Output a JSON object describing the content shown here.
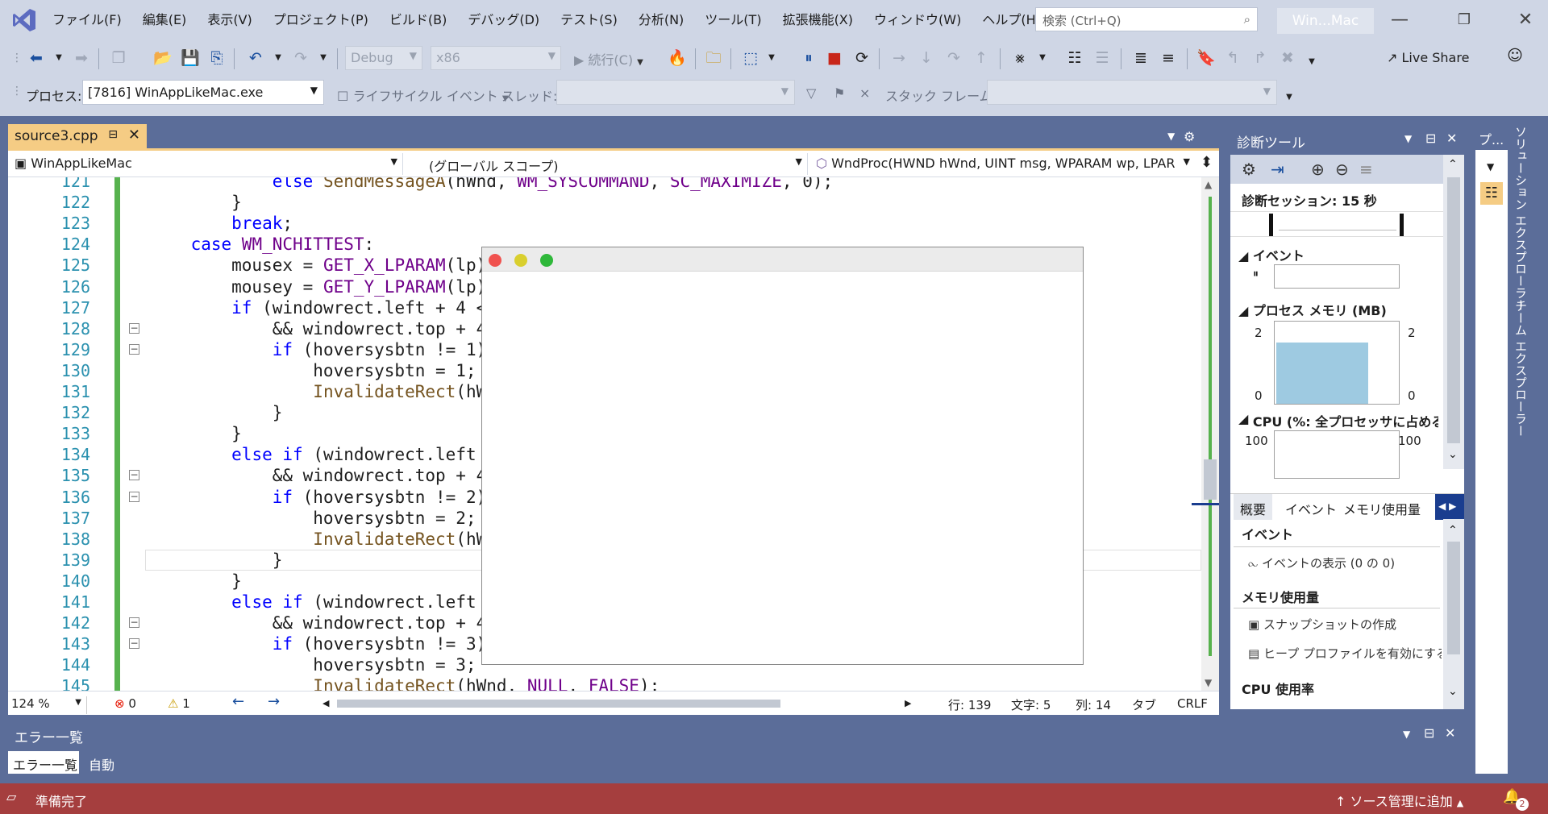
{
  "menubar": {
    "items": [
      "ファイル(F)",
      "編集(E)",
      "表示(V)",
      "プロジェクト(P)",
      "ビルド(B)",
      "デバッグ(D)",
      "テスト(S)",
      "分析(N)",
      "ツール(T)",
      "拡張機能(X)",
      "ウィンドウ(W)",
      "ヘルプ(H)"
    ],
    "search_placeholder": "検索 (Ctrl+Q)",
    "window_title": "Win...Mac"
  },
  "toolbar": {
    "config": "Debug",
    "platform": "x86",
    "continue_label": "続行(C)",
    "live_share": "Live Share"
  },
  "process_bar": {
    "label": "プロセス:",
    "process": "[7816] WinAppLikeMac.exe",
    "lifecycle": "ライフサイクル イベント",
    "thread": "スレッド:",
    "stack_frame": "スタック フレーム:"
  },
  "editor": {
    "tab_title": "source3.cpp",
    "nav_project": "WinAppLikeMac",
    "nav_scope": "(グローバル スコープ)",
    "nav_function": "WndProc(HWND hWnd, UINT msg, WPARAM wp, LPAR",
    "zoom": "124 %",
    "errors": "0",
    "warnings": "1",
    "line": "行: 139",
    "char": "文字: 5",
    "col": "列: 14",
    "tab": "タブ",
    "eol": "CRLF"
  },
  "code_lines": [
    {
      "n": "121",
      "fold": false,
      "segs": [
        [
          "",
          "            "
        ],
        [
          "kw",
          "else "
        ],
        [
          "fn",
          "SendMessageA"
        ],
        [
          "",
          "(hWnd, "
        ],
        [
          "mac",
          "WM_SYSCOMMAND"
        ],
        [
          "",
          ", "
        ],
        [
          "mac",
          "SC_MAXIMIZE"
        ],
        [
          "",
          ", 0);"
        ]
      ]
    },
    {
      "n": "122",
      "fold": false,
      "segs": [
        [
          "",
          "        }"
        ]
      ]
    },
    {
      "n": "123",
      "fold": false,
      "segs": [
        [
          "",
          "        "
        ],
        [
          "kw",
          "break"
        ],
        [
          "",
          ";"
        ]
      ]
    },
    {
      "n": "124",
      "fold": false,
      "segs": [
        [
          "",
          "    "
        ],
        [
          "kw",
          "case "
        ],
        [
          "mac",
          "WM_NCHITTEST"
        ],
        [
          "",
          ":"
        ]
      ]
    },
    {
      "n": "125",
      "fold": false,
      "segs": [
        [
          "",
          "        mousex = "
        ],
        [
          "mac",
          "GET_X_LPARAM"
        ],
        [
          "",
          "(lp);"
        ]
      ]
    },
    {
      "n": "126",
      "fold": false,
      "segs": [
        [
          "",
          "        mousey = "
        ],
        [
          "mac",
          "GET_Y_LPARAM"
        ],
        [
          "",
          "(lp);"
        ]
      ]
    },
    {
      "n": "127",
      "fold": false,
      "segs": [
        [
          "",
          "        "
        ],
        [
          "kw",
          "if "
        ],
        [
          "",
          "(windowrect.left + 4 < m"
        ]
      ]
    },
    {
      "n": "128",
      "fold": true,
      "segs": [
        [
          "",
          "            && windowrect.top + 4 <"
        ]
      ]
    },
    {
      "n": "129",
      "fold": true,
      "segs": [
        [
          "",
          "            "
        ],
        [
          "kw",
          "if "
        ],
        [
          "",
          "(hoversysbtn != 1) {"
        ]
      ]
    },
    {
      "n": "130",
      "fold": false,
      "segs": [
        [
          "",
          "                hoversysbtn = 1;"
        ]
      ]
    },
    {
      "n": "131",
      "fold": false,
      "segs": [
        [
          "",
          "                "
        ],
        [
          "fn",
          "InvalidateRect"
        ],
        [
          "",
          "(hWnd"
        ]
      ]
    },
    {
      "n": "132",
      "fold": false,
      "segs": [
        [
          "",
          "            }"
        ]
      ]
    },
    {
      "n": "133",
      "fold": false,
      "segs": [
        [
          "",
          "        }"
        ]
      ]
    },
    {
      "n": "134",
      "fold": false,
      "segs": [
        [
          "",
          "        "
        ],
        [
          "kw",
          "else if "
        ],
        [
          "",
          "(windowrect.left +"
        ]
      ]
    },
    {
      "n": "135",
      "fold": true,
      "segs": [
        [
          "",
          "            && windowrect.top + 4 <"
        ]
      ]
    },
    {
      "n": "136",
      "fold": true,
      "segs": [
        [
          "",
          "            "
        ],
        [
          "kw",
          "if "
        ],
        [
          "",
          "(hoversysbtn != 2) {"
        ]
      ]
    },
    {
      "n": "137",
      "fold": false,
      "segs": [
        [
          "",
          "                hoversysbtn = 2;"
        ]
      ]
    },
    {
      "n": "138",
      "fold": false,
      "segs": [
        [
          "",
          "                "
        ],
        [
          "fn",
          "InvalidateRect"
        ],
        [
          "",
          "(hWnd"
        ]
      ]
    },
    {
      "n": "139",
      "fold": false,
      "segs": [
        [
          "",
          "            }"
        ]
      ]
    },
    {
      "n": "140",
      "fold": false,
      "segs": [
        [
          "",
          "        }"
        ]
      ]
    },
    {
      "n": "141",
      "fold": false,
      "segs": [
        [
          "",
          "        "
        ],
        [
          "kw",
          "else if "
        ],
        [
          "",
          "(windowrect.left +"
        ]
      ]
    },
    {
      "n": "142",
      "fold": true,
      "segs": [
        [
          "",
          "            && windowrect.top + 4 <"
        ]
      ]
    },
    {
      "n": "143",
      "fold": true,
      "segs": [
        [
          "",
          "            "
        ],
        [
          "kw",
          "if "
        ],
        [
          "",
          "(hoversysbtn != 3) {"
        ]
      ]
    },
    {
      "n": "144",
      "fold": false,
      "segs": [
        [
          "",
          "                hoversysbtn = 3;"
        ]
      ]
    },
    {
      "n": "145",
      "fold": false,
      "segs": [
        [
          "",
          "                "
        ],
        [
          "fn",
          "InvalidateRect"
        ],
        [
          "",
          "(hWnd, "
        ],
        [
          "mac",
          "NULL"
        ],
        [
          "",
          ", "
        ],
        [
          "mac",
          "FALSE"
        ],
        [
          "",
          ");"
        ]
      ]
    }
  ],
  "diagnostics": {
    "title": "診断ツール",
    "session": "診断セッション: 15 秒",
    "events_title": "イベント",
    "memory_title": "プロセス メモリ (MB)",
    "memory_max": "2",
    "memory_min": "0",
    "memory_fill": 0.75,
    "cpu_title": "CPU (%: 全プロセッサに占める割合)",
    "cpu_max": "100",
    "tabs": [
      "概要",
      "イベント",
      "メモリ使用量"
    ],
    "list_events_head": "イベント",
    "list_events_item": "イベントの表示 (0 の 0)",
    "list_memory_head": "メモリ使用量",
    "list_snapshot": "スナップショットの作成",
    "list_heap": "ヒープ プロファイルを有効にする",
    "list_cpu_head": "CPU 使用率"
  },
  "side": {
    "strip_head": "プ...",
    "solution_explorer": "ソリューション エクスプローラー",
    "team_explorer": "チーム エクスプローラー"
  },
  "error_panel": {
    "title": "エラー一覧",
    "tab_errors": "エラー一覧",
    "tab_auto": "自動"
  },
  "statusbar": {
    "ready": "準備完了",
    "source_control": "ソース管理に追加",
    "notifications": "2"
  },
  "colors": {
    "accent": "#5b6d99",
    "tab_active": "#f5cc84",
    "status_bar": "#a53e3e",
    "memory_bar": "#9ecae1"
  }
}
